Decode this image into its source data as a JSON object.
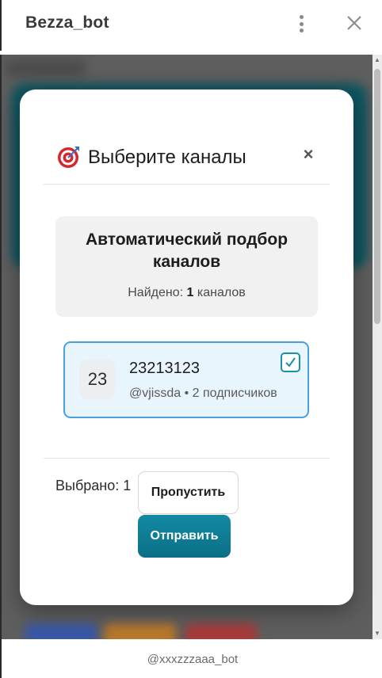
{
  "window": {
    "title": "Bezza_bot",
    "menu_icon": "more-vertical-icon",
    "close_icon": "close-icon"
  },
  "modal": {
    "title_icon": "direct-hit-target-icon",
    "title": "Выберите каналы",
    "close_label": "×",
    "auto_select": {
      "title": "Автоматический подбор каналов",
      "found_prefix": "Найдено: ",
      "found_count": "1",
      "found_suffix": " каналов"
    },
    "channels": [
      {
        "avatar_text": "23",
        "name": "23213123",
        "subtitle": "@vjissda • 2 подписчиков",
        "selected": true
      }
    ],
    "footer": {
      "selected_label": "Выбрано: 1",
      "skip_button": "Пропустить",
      "send_button": "Отправить"
    }
  },
  "bottom_bar": {
    "bot_handle": "@xxxzzzaaa_bot"
  },
  "colors": {
    "accent": "#1790a8",
    "send_button": "#0e7d95",
    "channel_border": "#4a9fdc",
    "channel_bg": "#e8f5fd"
  }
}
